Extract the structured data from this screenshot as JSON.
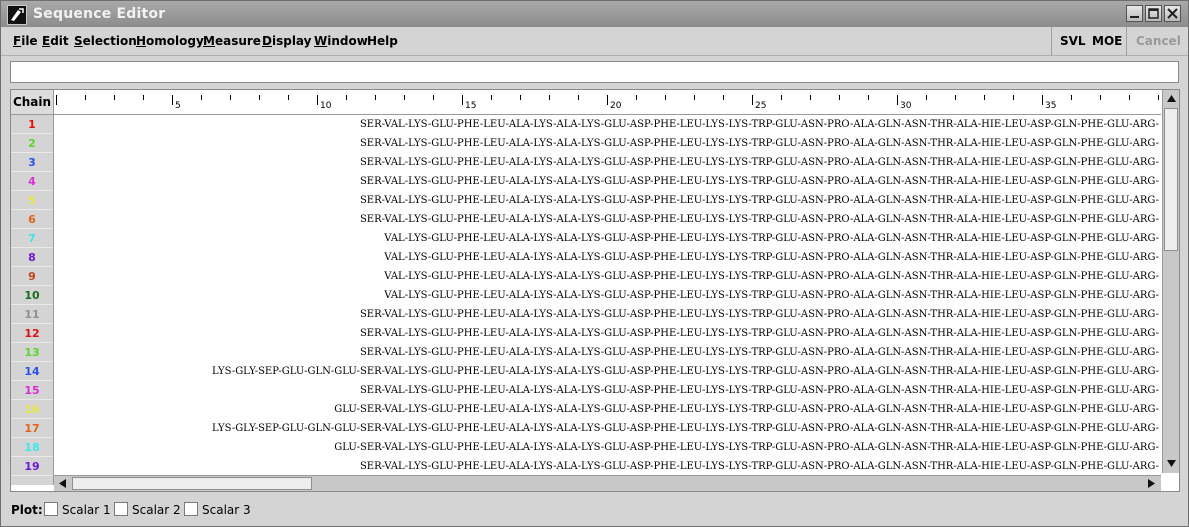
{
  "window": {
    "title": "Sequence Editor"
  },
  "menu": [
    {
      "label": "File",
      "key": "F",
      "rest": "ile"
    },
    {
      "label": "Edit",
      "key": "E",
      "rest": "dit"
    },
    {
      "label": "Selection",
      "key": "S",
      "rest": "election"
    },
    {
      "label": "Homology",
      "key": "H",
      "rest": "omology"
    },
    {
      "label": "Measure",
      "key": "M",
      "rest": "easure"
    },
    {
      "label": "Display",
      "key": "D",
      "rest": "isplay"
    },
    {
      "label": "Window",
      "key": "W",
      "rest": "indow"
    },
    {
      "label": "Help",
      "key": "",
      "rest": "Help"
    }
  ],
  "toolbar": {
    "svl_label": "SVL",
    "moe_label": "MOE",
    "cancel_label": "Cancel"
  },
  "command": {
    "value": ""
  },
  "table": {
    "chain_header": "Chain",
    "ruler_labels": [
      "5",
      "10",
      "15",
      "20",
      "25",
      "30",
      "35"
    ],
    "rows": [
      {
        "chain": "1",
        "color": "#e01010",
        "seq": "SER-VAL-LYS-GLU-PHE-LEU-ALA-LYS-ALA-LYS-GLU-ASP-PHE-LEU-LYS-LYS-TRP-GLU-ASN-PRO-ALA-GLN-ASN-THR-ALA-HIE-LEU-ASP-GLN-PHE-GLU-ARG-"
      },
      {
        "chain": "2",
        "color": "#59d62a",
        "seq": "SER-VAL-LYS-GLU-PHE-LEU-ALA-LYS-ALA-LYS-GLU-ASP-PHE-LEU-LYS-LYS-TRP-GLU-ASN-PRO-ALA-GLN-ASN-THR-ALA-HIE-LEU-ASP-GLN-PHE-GLU-ARG-"
      },
      {
        "chain": "3",
        "color": "#2a4fe8",
        "seq": "SER-VAL-LYS-GLU-PHE-LEU-ALA-LYS-ALA-LYS-GLU-ASP-PHE-LEU-LYS-LYS-TRP-GLU-ASN-PRO-ALA-GLN-ASN-THR-ALA-HIE-LEU-ASP-GLN-PHE-GLU-ARG-"
      },
      {
        "chain": "4",
        "color": "#e02ad8",
        "seq": "SER-VAL-LYS-GLU-PHE-LEU-ALA-LYS-ALA-LYS-GLU-ASP-PHE-LEU-LYS-LYS-TRP-GLU-ASN-PRO-ALA-GLN-ASN-THR-ALA-HIE-LEU-ASP-GLN-PHE-GLU-ARG-"
      },
      {
        "chain": "5",
        "color": "#e6e640",
        "seq": "SER-VAL-LYS-GLU-PHE-LEU-ALA-LYS-ALA-LYS-GLU-ASP-PHE-LEU-LYS-LYS-TRP-GLU-ASN-PRO-ALA-GLN-ASN-THR-ALA-HIE-LEU-ASP-GLN-PHE-GLU-ARG-"
      },
      {
        "chain": "6",
        "color": "#e0641a",
        "seq": "SER-VAL-LYS-GLU-PHE-LEU-ALA-LYS-ALA-LYS-GLU-ASP-PHE-LEU-LYS-LYS-TRP-GLU-ASN-PRO-ALA-GLN-ASN-THR-ALA-HIE-LEU-ASP-GLN-PHE-GLU-ARG-"
      },
      {
        "chain": "7",
        "color": "#3ee6e6",
        "seq": "VAL-LYS-GLU-PHE-LEU-ALA-LYS-ALA-LYS-GLU-ASP-PHE-LEU-LYS-LYS-TRP-GLU-ASN-PRO-ALA-GLN-ASN-THR-ALA-HIE-LEU-ASP-GLN-PHE-GLU-ARG-"
      },
      {
        "chain": "8",
        "color": "#6a1ad8",
        "seq": "VAL-LYS-GLU-PHE-LEU-ALA-LYS-ALA-LYS-GLU-ASP-PHE-LEU-LYS-LYS-TRP-GLU-ASN-PRO-ALA-GLN-ASN-THR-ALA-HIE-LEU-ASP-GLN-PHE-GLU-ARG-"
      },
      {
        "chain": "9",
        "color": "#c0441a",
        "seq": "VAL-LYS-GLU-PHE-LEU-ALA-LYS-ALA-LYS-GLU-ASP-PHE-LEU-LYS-LYS-TRP-GLU-ASN-PRO-ALA-GLN-ASN-THR-ALA-HIE-LEU-ASP-GLN-PHE-GLU-ARG-"
      },
      {
        "chain": "10",
        "color": "#1a6a1a",
        "seq": "VAL-LYS-GLU-PHE-LEU-ALA-LYS-ALA-LYS-GLU-ASP-PHE-LEU-LYS-LYS-TRP-GLU-ASN-PRO-ALA-GLN-ASN-THR-ALA-HIE-LEU-ASP-GLN-PHE-GLU-ARG-"
      },
      {
        "chain": "11",
        "color": "#8f8f8f",
        "seq": "SER-VAL-LYS-GLU-PHE-LEU-ALA-LYS-ALA-LYS-GLU-ASP-PHE-LEU-LYS-LYS-TRP-GLU-ASN-PRO-ALA-GLN-ASN-THR-ALA-HIE-LEU-ASP-GLN-PHE-GLU-ARG-"
      },
      {
        "chain": "12",
        "color": "#e01010",
        "seq": "SER-VAL-LYS-GLU-PHE-LEU-ALA-LYS-ALA-LYS-GLU-ASP-PHE-LEU-LYS-LYS-TRP-GLU-ASN-PRO-ALA-GLN-ASN-THR-ALA-HIE-LEU-ASP-GLN-PHE-GLU-ARG-"
      },
      {
        "chain": "13",
        "color": "#59d62a",
        "seq": "SER-VAL-LYS-GLU-PHE-LEU-ALA-LYS-ALA-LYS-GLU-ASP-PHE-LEU-LYS-LYS-TRP-GLU-ASN-PRO-ALA-GLN-ASN-THR-ALA-HIE-LEU-ASP-GLN-PHE-GLU-ARG-"
      },
      {
        "chain": "14",
        "color": "#2a4fe8",
        "seq": "LYS-GLY-SEP-GLU-GLN-GLU-SER-VAL-LYS-GLU-PHE-LEU-ALA-LYS-ALA-LYS-GLU-ASP-PHE-LEU-LYS-LYS-TRP-GLU-ASN-PRO-ALA-GLN-ASN-THR-ALA-HIE-LEU-ASP-GLN-PHE-GLU-ARG-"
      },
      {
        "chain": "15",
        "color": "#e02ad8",
        "seq": "SER-VAL-LYS-GLU-PHE-LEU-ALA-LYS-ALA-LYS-GLU-ASP-PHE-LEU-LYS-LYS-TRP-GLU-ASN-PRO-ALA-GLN-ASN-THR-ALA-HIE-LEU-ASP-GLN-PHE-GLU-ARG-"
      },
      {
        "chain": "16",
        "color": "#e6e640",
        "seq": "GLU-SER-VAL-LYS-GLU-PHE-LEU-ALA-LYS-ALA-LYS-GLU-ASP-PHE-LEU-LYS-LYS-TRP-GLU-ASN-PRO-ALA-GLN-ASN-THR-ALA-HIE-LEU-ASP-GLN-PHE-GLU-ARG-"
      },
      {
        "chain": "17",
        "color": "#e0641a",
        "seq": "LYS-GLY-SEP-GLU-GLN-GLU-SER-VAL-LYS-GLU-PHE-LEU-ALA-LYS-ALA-LYS-GLU-ASP-PHE-LEU-LYS-LYS-TRP-GLU-ASN-PRO-ALA-GLN-ASN-THR-ALA-HIE-LEU-ASP-GLN-PHE-GLU-ARG-"
      },
      {
        "chain": "18",
        "color": "#3ee6e6",
        "seq": "GLU-SER-VAL-LYS-GLU-PHE-LEU-ALA-LYS-ALA-LYS-GLU-ASP-PHE-LEU-LYS-LYS-TRP-GLU-ASN-PRO-ALA-GLN-ASN-THR-ALA-HIE-LEU-ASP-GLN-PHE-GLU-ARG-"
      },
      {
        "chain": "19",
        "color": "#6a1ad8",
        "seq": "SER-VAL-LYS-GLU-PHE-LEU-ALA-LYS-ALA-LYS-GLU-ASP-PHE-LEU-LYS-LYS-TRP-GLU-ASN-PRO-ALA-GLN-ASN-THR-ALA-HIE-LEU-ASP-GLN-PHE-GLU-ARG-"
      }
    ]
  },
  "plot": {
    "label": "Plot:",
    "options": [
      {
        "label": "Scalar 1",
        "checked": false
      },
      {
        "label": "Scalar 2",
        "checked": false
      },
      {
        "label": "Scalar 3",
        "checked": false
      }
    ]
  },
  "icons": {
    "app": "app-logo-icon",
    "minimize": "minimize-icon",
    "maximize": "maximize-icon",
    "close": "close-icon",
    "scroll_up": "arrow-up-icon",
    "scroll_down": "arrow-down-icon",
    "scroll_left": "arrow-left-icon",
    "scroll_right": "arrow-right-icon"
  }
}
